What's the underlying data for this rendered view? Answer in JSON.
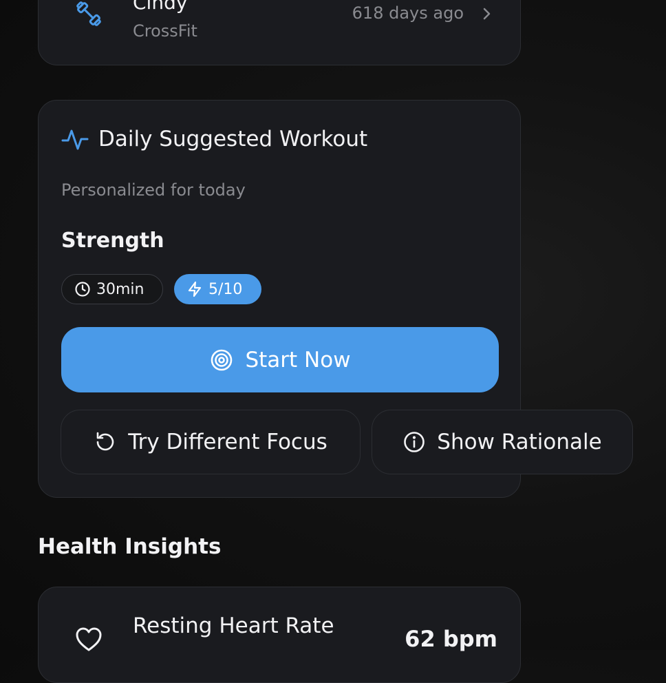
{
  "recent_workout": {
    "name": "Cindy",
    "type": "CrossFit",
    "last_done": "618 days ago",
    "icon": "dumbbell-icon"
  },
  "suggestion": {
    "title": "Daily Suggested Workout",
    "title_icon": "activity-icon",
    "subtitle": "Personalized for today",
    "workout_focus": "Strength",
    "duration": "30min",
    "intensity": "5/10",
    "start_label": "Start Now",
    "try_focus_label": "Try Different Focus",
    "rationale_label": "Show Rationale"
  },
  "health": {
    "heading": "Health Insights",
    "metric_name": "Resting Heart Rate",
    "metric_value": "62 bpm"
  },
  "colors": {
    "accent": "#4a9ae8",
    "card_bg": "#1a1b1f",
    "muted_text": "#8a8b90"
  }
}
